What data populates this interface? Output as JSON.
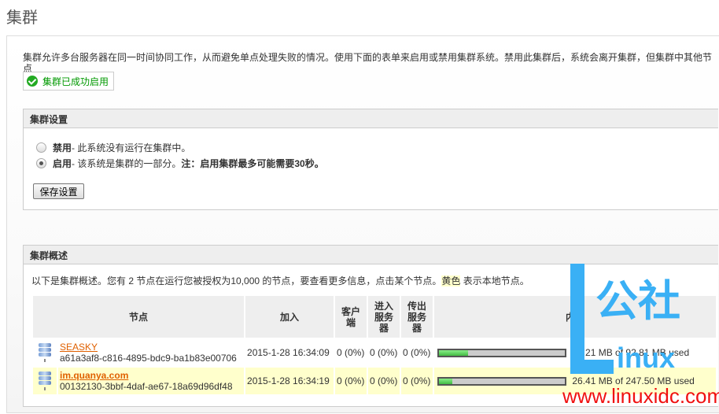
{
  "page_title": "集群",
  "description": "集群允许多台服务器在同一时间协同工作，从而避免单点处理失败的情况。使用下面的表单来启用或禁用集群系统。禁用此集群后，系统会离开集群，但集群中其他节点",
  "success_message": "集群已成功启用",
  "settings": {
    "title": "集群设置",
    "options": [
      {
        "label": "禁用",
        "desc": " - 此系统没有运行在集群中。",
        "selected": false
      },
      {
        "label": "启用",
        "desc": " - 该系统是集群的一部分。",
        "note": " 注：启用集群最多可能需要30秒。",
        "selected": true
      }
    ],
    "save_label": "保存设置"
  },
  "overview": {
    "title": "集群概述",
    "text": "以下是集群概述。您有 2 节点在运行您被授权为10,000 的节点，要查看更多信息，点击某个节点。",
    "highlight": "黄色",
    "text_after": " 表示本地节点。",
    "columns": [
      "节点",
      "加入",
      "客户端",
      "进入服务器",
      "传出服务器",
      "内存"
    ],
    "rows": [
      {
        "name": "SEASKY",
        "id": "a61a3af8-c816-4895-bdc9-ba1b83e00706",
        "joined": "2015-1-28 16:34:09",
        "clients": "0 (0%)",
        "incoming": "0 (0%)",
        "outgoing": "0 (0%)",
        "memory": "21.21 MB of 92.81 MB used",
        "memory_fraction": 0.23,
        "local": false
      },
      {
        "name": "im.quanya.com",
        "id": "00132130-3bbf-4daf-ae67-18a69d96df48",
        "joined": "2015-1-28 16:34:19",
        "clients": "0 (0%)",
        "incoming": "0 (0%)",
        "outgoing": "0 (0%)",
        "memory": "26.41 MB of 247.50 MB used",
        "memory_fraction": 0.107,
        "local": true
      }
    ]
  },
  "watermark": {
    "logo_top": "公社",
    "logo_bottom": "inux",
    "url": "www.linuxidc.com"
  },
  "colors": {
    "accent_link": "#e06000",
    "success": "#009900",
    "local_row": "#ffffcc",
    "bar_fill": "#44bb44"
  }
}
